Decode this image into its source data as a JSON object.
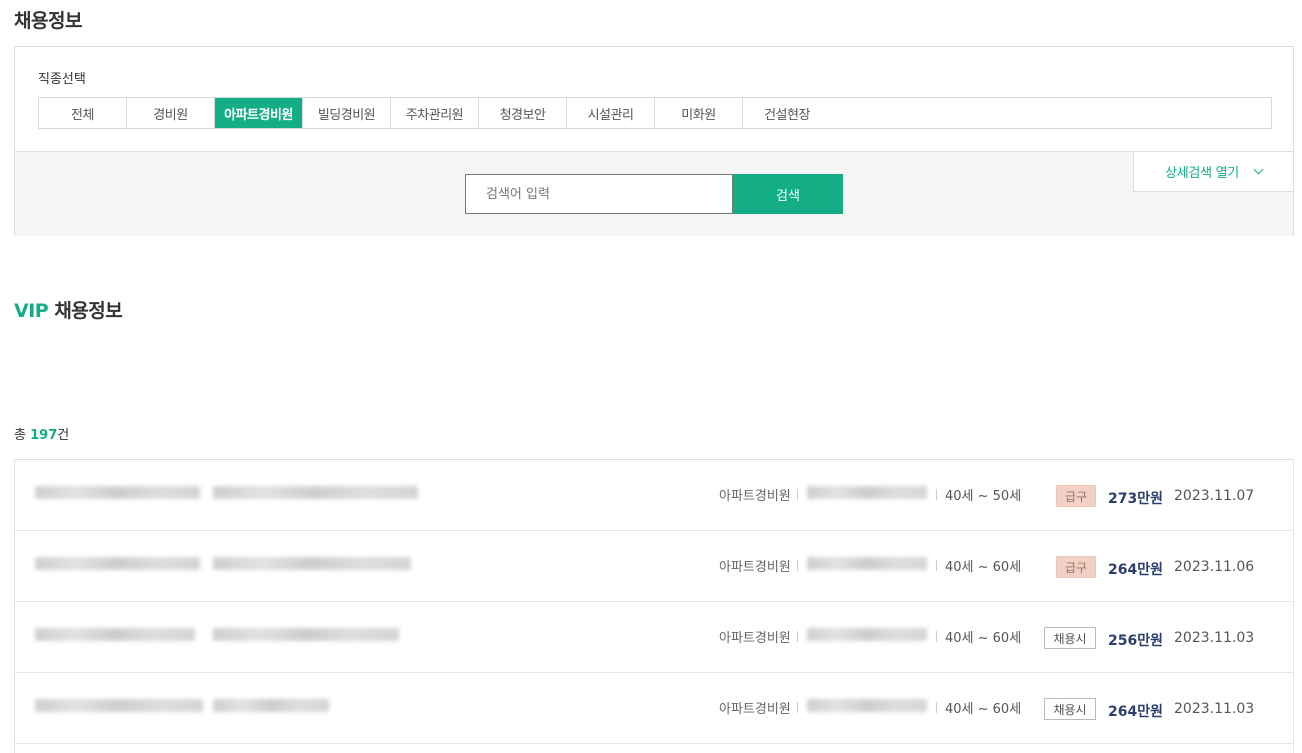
{
  "header": {
    "title": "채용정보"
  },
  "filter": {
    "job_label": "직종선택",
    "tabs": [
      "전체",
      "경비원",
      "아파트경비원",
      "빌딩경비원",
      "주차관리원",
      "청경보안",
      "시설관리",
      "미화원",
      "건설현장"
    ],
    "active_tab": "아파트경비원"
  },
  "search": {
    "placeholder": "검색어 입력",
    "button_label": "검색",
    "detail_toggle_label": "상세검색 열기"
  },
  "vip": {
    "prefix": "VIP",
    "title": "채용정보"
  },
  "total": {
    "prefix": "총",
    "count": "197",
    "suffix": "건"
  },
  "jobs": [
    {
      "category": "아파트경비원",
      "age": "40세 ~ 50세",
      "badge": "급구",
      "badge_type": "urgent",
      "salary": "273만원",
      "date": "2023.11.07"
    },
    {
      "category": "아파트경비원",
      "age": "40세 ~ 60세",
      "badge": "급구",
      "badge_type": "urgent",
      "salary": "264만원",
      "date": "2023.11.06"
    },
    {
      "category": "아파트경비원",
      "age": "40세 ~ 60세",
      "badge": "채용시",
      "badge_type": "until",
      "salary": "256만원",
      "date": "2023.11.03"
    },
    {
      "category": "아파트경비원",
      "age": "40세 ~ 60세",
      "badge": "채용시",
      "badge_type": "until",
      "salary": "264만원",
      "date": "2023.11.03"
    }
  ],
  "colors": {
    "accent": "#13ae85",
    "salary": "#2c3e6b",
    "urgent_bg": "#f1d1c6"
  }
}
